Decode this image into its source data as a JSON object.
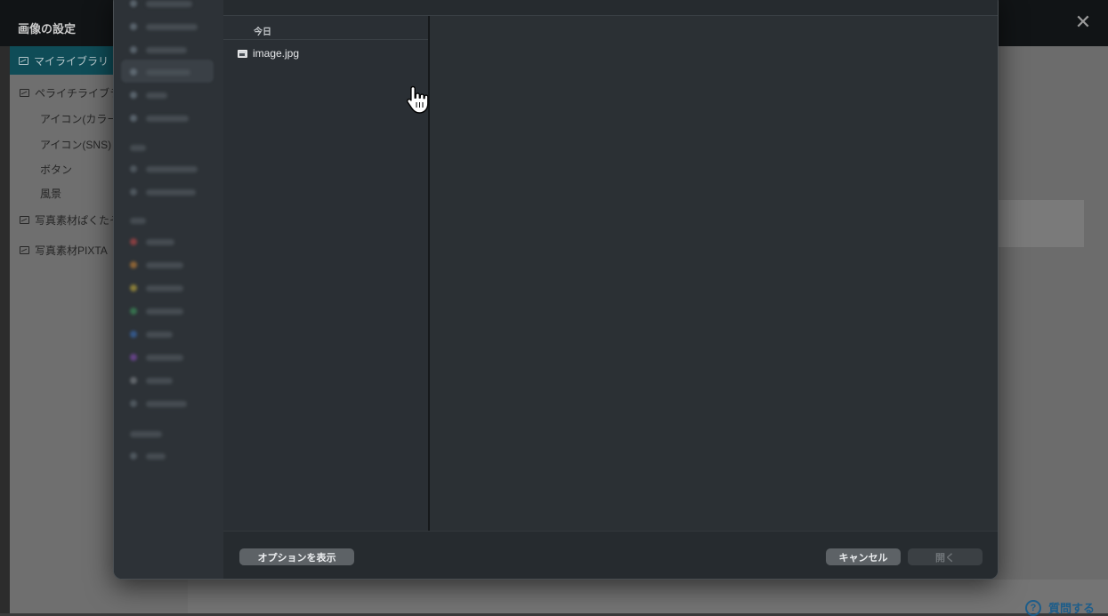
{
  "background": {
    "title": "画像の設定",
    "close_glyph": "✕",
    "sidebar": {
      "items": [
        {
          "label": "マイライブラリ",
          "icon": "image-icon",
          "active": true
        },
        {
          "label": "ペライチライブラリ",
          "icon": "image-icon"
        },
        {
          "label": "アイコン(カラー)"
        },
        {
          "label": "アイコン(SNS)"
        },
        {
          "label": "ボタン"
        },
        {
          "label": "風景"
        },
        {
          "label": "写真素材ぱくたそ",
          "icon": "image-icon"
        },
        {
          "label": "写真素材PIXTA",
          "icon": "image-icon"
        }
      ]
    },
    "help": {
      "icon": "question-circle-icon",
      "glyph": "?",
      "label": "質問する"
    }
  },
  "dialog": {
    "list": {
      "header": "今日",
      "files": [
        {
          "name": "image.jpg",
          "icon": "image-file-icon"
        }
      ]
    },
    "footer": {
      "options_label": "オプションを表示",
      "cancel_label": "キャンセル",
      "open_label": "開く"
    }
  },
  "colors": {
    "active_item": "#0f4c57",
    "dialog_bg": "#262b2f",
    "button": "#5d6266",
    "help": "#1d5d8a"
  }
}
